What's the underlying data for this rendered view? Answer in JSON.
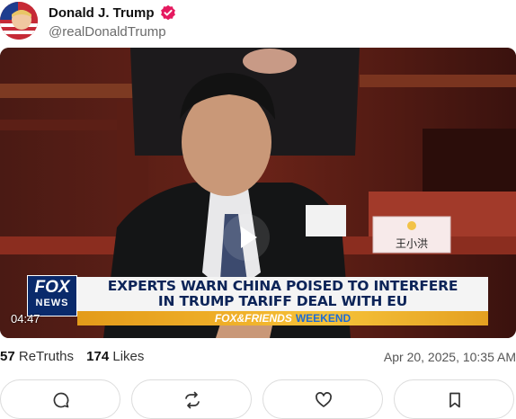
{
  "post": {
    "author_name": "Donald J. Trump",
    "author_handle": "@realDonaldTrump",
    "verified_icon": "verified-badge-icon",
    "avatar_icon": "avatar"
  },
  "video": {
    "timestamp": "04:47",
    "chyron_line1": "EXPERTS WARN CHINA POISED TO INTERFERE",
    "chyron_line2": "IN TRUMP TARIFF DEAL WITH EU",
    "show_name": "FOX&FRIENDS",
    "show_suffix": "WEEKEND",
    "logo_top": "FOX",
    "logo_bottom": "NEWS",
    "nameplate": "王小洪",
    "play_icon": "play-icon"
  },
  "stats": {
    "retruths_count": "57",
    "retruths_label": "ReTruths",
    "likes_count": "174",
    "likes_label": "Likes",
    "date": "Apr 20, 2025, 10:35 AM"
  },
  "actions": [
    {
      "name": "reply-button",
      "icon": "comment-icon"
    },
    {
      "name": "retruth-button",
      "icon": "retruth-icon"
    },
    {
      "name": "like-button",
      "icon": "heart-icon"
    },
    {
      "name": "bookmark-button",
      "icon": "bookmark-icon"
    }
  ]
}
